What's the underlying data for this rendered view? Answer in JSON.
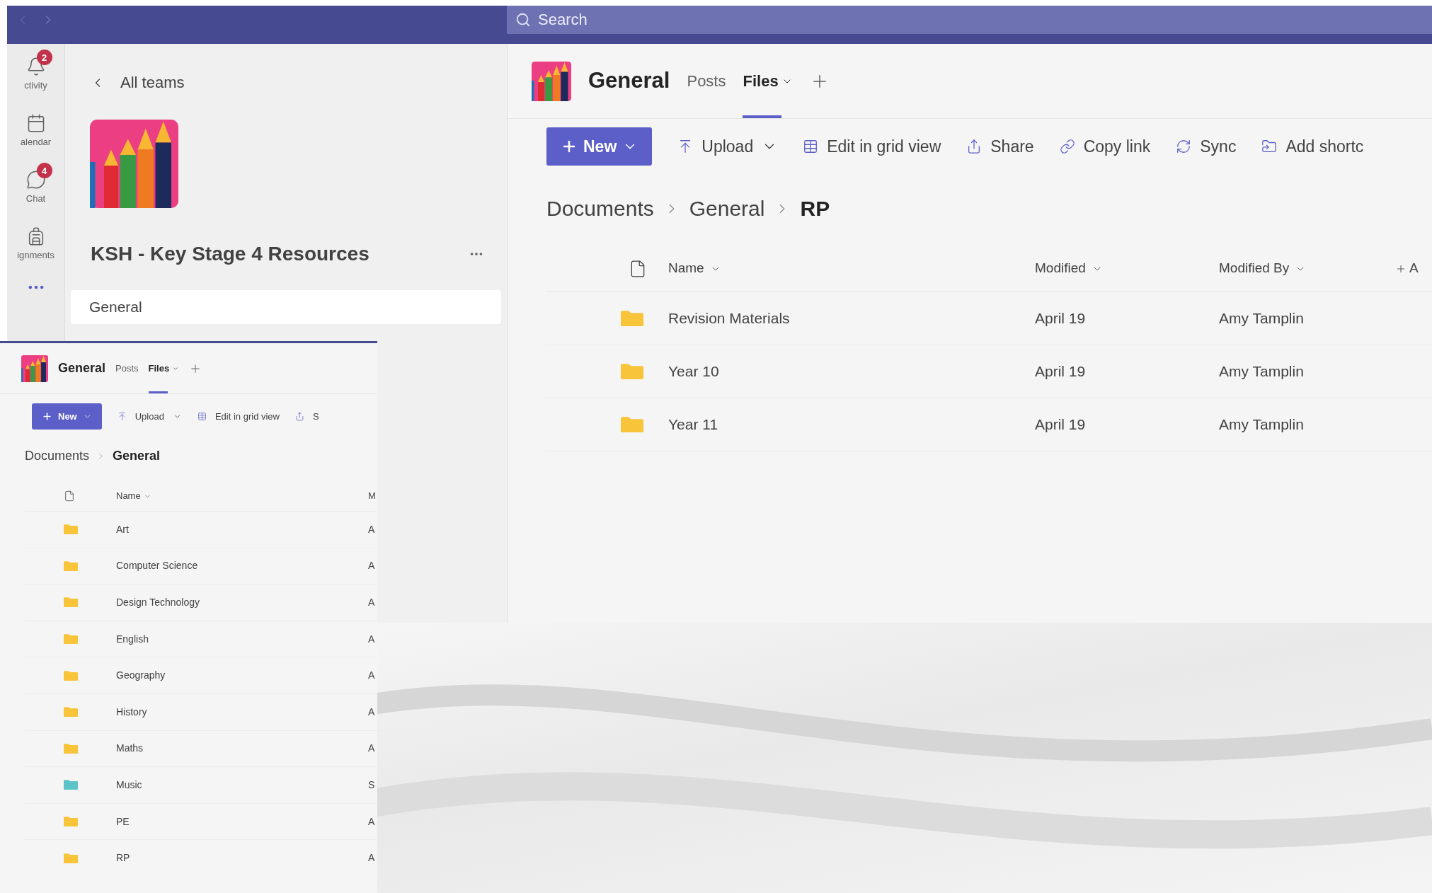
{
  "top_bar": {
    "search": {
      "placeholder": "Search"
    }
  },
  "app_bar": [
    {
      "label": "ctivity",
      "badge": "2"
    },
    {
      "label": "alendar"
    },
    {
      "label": "Chat",
      "badge": "4"
    },
    {
      "label": "ignments"
    }
  ],
  "team_panel": {
    "back_link": "All teams",
    "team_name": "KSH - Key Stage 4 Resources",
    "channels": [
      {
        "label": "General",
        "selected": true
      }
    ]
  },
  "main": {
    "channel": "General",
    "tabs": [
      {
        "label": "Posts",
        "selected": false,
        "dropdown": false
      },
      {
        "label": "Files",
        "selected": true,
        "dropdown": true
      }
    ],
    "toolbar": [
      {
        "label": "New",
        "kind": "primary",
        "dropdown": true
      },
      {
        "label": "Upload",
        "kind": "plain",
        "dropdown": true
      },
      {
        "label": "Edit in grid view",
        "kind": "plain",
        "dropdown": false
      },
      {
        "label": "Share",
        "kind": "plain",
        "dropdown": false
      },
      {
        "label": "Copy link",
        "kind": "plain",
        "dropdown": false
      },
      {
        "label": "Sync",
        "kind": "plain",
        "dropdown": false
      },
      {
        "label": "Add shortc",
        "kind": "plain",
        "dropdown": false
      }
    ],
    "breadcrumb": [
      "Documents",
      "General",
      "RP"
    ],
    "columns": [
      {
        "label": "Name",
        "kind": "sort"
      },
      {
        "label": "Modified",
        "kind": "sort"
      },
      {
        "label": "Modified By",
        "kind": "sort"
      },
      {
        "label": "A",
        "kind": "add"
      }
    ],
    "rows": [
      {
        "name": "Revision Materials",
        "modified": "April 19",
        "modified_by": "Amy Tamplin",
        "color": "#f8c43a"
      },
      {
        "name": "Year 10",
        "modified": "April 19",
        "modified_by": "Amy Tamplin",
        "color": "#f8c43a"
      },
      {
        "name": "Year 11",
        "modified": "April 19",
        "modified_by": "Amy Tamplin",
        "color": "#f8c43a"
      }
    ]
  },
  "inset": {
    "channel": "General",
    "tabs": [
      {
        "label": "Posts",
        "selected": false,
        "dropdown": false
      },
      {
        "label": "Files",
        "selected": true,
        "dropdown": true
      }
    ],
    "toolbar": [
      {
        "label": "New",
        "kind": "primary",
        "dropdown": true
      },
      {
        "label": "Upload",
        "kind": "plain",
        "dropdown": true
      },
      {
        "label": "Edit in grid view",
        "kind": "plain",
        "dropdown": false
      },
      {
        "label": "S",
        "kind": "plain",
        "dropdown": false
      }
    ],
    "breadcrumb": [
      "Documents",
      "General"
    ],
    "columns": [
      {
        "label": "Name",
        "kind": "sort"
      },
      {
        "label": "M",
        "kind": "plain"
      }
    ],
    "rows": [
      {
        "name": "Art",
        "column_2": "A",
        "color": "#f8c43a"
      },
      {
        "name": "Computer Science",
        "column_2": "A",
        "color": "#f8c43a"
      },
      {
        "name": "Design Technology",
        "column_2": "A",
        "color": "#f8c43a"
      },
      {
        "name": "English",
        "column_2": "A",
        "color": "#f8c43a"
      },
      {
        "name": "Geography",
        "column_2": "A",
        "color": "#f8c43a"
      },
      {
        "name": "History",
        "column_2": "A",
        "color": "#f8c43a"
      },
      {
        "name": "Maths",
        "column_2": "A",
        "color": "#f8c43a"
      },
      {
        "name": "Music",
        "column_2": "S",
        "color": "#5cc4c8"
      },
      {
        "name": "PE",
        "column_2": "A",
        "color": "#f8c43a"
      },
      {
        "name": "RP",
        "column_2": "A",
        "color": "#f8c43a"
      }
    ]
  }
}
